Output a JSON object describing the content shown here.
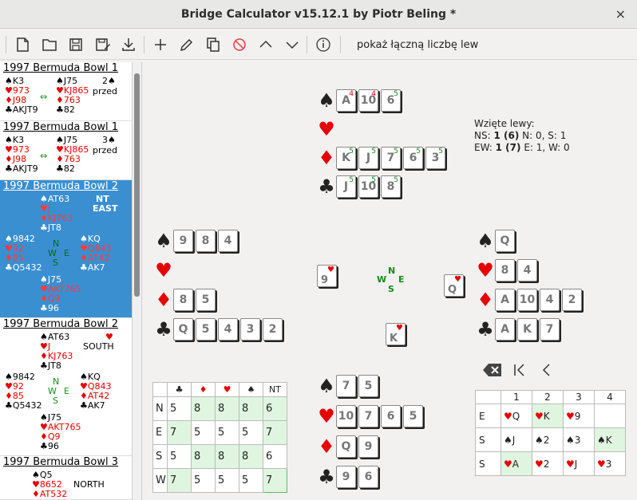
{
  "window": {
    "title": "Bridge Calculator v15.12.1 by Piotr Beling *",
    "close": "×"
  },
  "toolbar": {
    "option_label": "pokaż łączną liczbę lew"
  },
  "sidebar": {
    "deals": [
      {
        "title": "1997 Bermuda Bowl 1",
        "w": [
          "♠K3",
          "♥973",
          "♦J98",
          "♣AKJT9"
        ],
        "e": [
          "♠J75",
          "♥KJ865",
          "♦763",
          "♣82"
        ],
        "arrow": "⇔",
        "info1": "2♠",
        "info2": "przed"
      },
      {
        "title": "1997 Bermuda Bowl 1",
        "w": [
          "♠K3",
          "♥973",
          "♦J98",
          "♣AKJT9"
        ],
        "e": [
          "♠J75",
          "♥KJ865",
          "♦763",
          "♣82"
        ],
        "arrow": "⇔",
        "info1": "3♠",
        "info2": "przed"
      },
      {
        "title": "1997 Bermuda Bowl 2",
        "n": [
          "♠AT63",
          "♥J",
          "♦KJ763",
          "♣JT8"
        ],
        "w": [
          "♠9842",
          "♥92",
          "♦85",
          "♣Q5432"
        ],
        "e": [
          "♠KQ",
          "♥Q843",
          "♦AT42",
          "♣AK7"
        ],
        "s": [
          "♠J75",
          "♥AKT765",
          "♦Q9",
          "♣96"
        ],
        "c": [
          "N",
          "W",
          "E",
          "S"
        ],
        "info1": "NT",
        "info2": "EAST"
      },
      {
        "title": "1997 Bermuda Bowl 2",
        "n": [
          "♠AT63",
          "♥J",
          "♦KJ763",
          "♣JT8"
        ],
        "w": [
          "♠9842",
          "♥92",
          "♦85",
          "♣Q5432"
        ],
        "e": [
          "♠KQ",
          "♥Q843",
          "♦AT42",
          "♣AK7"
        ],
        "s": [
          "♠J75",
          "♥AKT765",
          "♦Q9",
          "♣96"
        ],
        "c": [
          "N",
          "W",
          "E",
          "S"
        ],
        "info1": "♥",
        "info2": "SOUTH"
      },
      {
        "title": "1997 Bermuda Bowl 3",
        "n": [
          "♠Q5",
          "♥8652",
          "♦AT532"
        ],
        "info2": "NORTH"
      }
    ]
  },
  "hands": {
    "north": [
      {
        "suit": "♠",
        "cards": [
          {
            "r": "A",
            "t": "4"
          },
          {
            "r": "10",
            "t": "4"
          },
          {
            "r": "6",
            "t": "5"
          }
        ]
      },
      {
        "suit": "♥",
        "cards": []
      },
      {
        "suit": "♦",
        "cards": [
          {
            "r": "K",
            "t": "5"
          },
          {
            "r": "J",
            "t": "5"
          },
          {
            "r": "7",
            "t": "5"
          },
          {
            "r": "6",
            "t": "5"
          },
          {
            "r": "3",
            "t": "5"
          }
        ]
      },
      {
        "suit": "♣",
        "cards": [
          {
            "r": "J",
            "t": "5"
          },
          {
            "r": "10",
            "t": "5"
          },
          {
            "r": "8",
            "t": "5"
          }
        ]
      }
    ],
    "west": [
      {
        "suit": "♠",
        "cards": [
          {
            "r": "9"
          },
          {
            "r": "8"
          },
          {
            "r": "4"
          }
        ]
      },
      {
        "suit": "♥",
        "cards": []
      },
      {
        "suit": "♦",
        "cards": [
          {
            "r": "8"
          },
          {
            "r": "5"
          }
        ]
      },
      {
        "suit": "♣",
        "cards": [
          {
            "r": "Q"
          },
          {
            "r": "5"
          },
          {
            "r": "4"
          },
          {
            "r": "3"
          },
          {
            "r": "2"
          }
        ]
      }
    ],
    "east": [
      {
        "suit": "♠",
        "cards": [
          {
            "r": "Q"
          }
        ]
      },
      {
        "suit": "♥",
        "cards": [
          {
            "r": "8"
          },
          {
            "r": "4"
          }
        ]
      },
      {
        "suit": "♦",
        "cards": [
          {
            "r": "A"
          },
          {
            "r": "10"
          },
          {
            "r": "4"
          },
          {
            "r": "2"
          }
        ]
      },
      {
        "suit": "♣",
        "cards": [
          {
            "r": "A"
          },
          {
            "r": "K"
          },
          {
            "r": "7"
          }
        ]
      }
    ],
    "south": [
      {
        "suit": "♠",
        "cards": [
          {
            "r": "7"
          },
          {
            "r": "5"
          }
        ]
      },
      {
        "suit": "♥",
        "cards": [
          {
            "r": "10"
          },
          {
            "r": "7"
          },
          {
            "r": "6"
          },
          {
            "r": "5"
          }
        ]
      },
      {
        "suit": "♦",
        "cards": [
          {
            "r": "Q"
          },
          {
            "r": "9"
          }
        ]
      },
      {
        "suit": "♣",
        "cards": [
          {
            "r": "9"
          },
          {
            "r": "6"
          }
        ]
      }
    ]
  },
  "trick": {
    "west": {
      "r": "9",
      "s": "♥"
    },
    "east": {
      "r": "Q",
      "s": "♥"
    },
    "south": {
      "r": "K",
      "s": "♥"
    }
  },
  "compass": {
    "n": "N",
    "w": "W",
    "e": "E",
    "s": "S"
  },
  "tricks_taken": {
    "label": "Wzięte lewy:",
    "ns_prefix": "NS:",
    "ns_value": "1 (6)",
    "ns_rest": "N: 0, S: 1",
    "ew_prefix": "EW:",
    "ew_value": "1 (7)",
    "ew_rest": "E: 1, W: 0"
  },
  "dd_table": {
    "header": [
      "♣",
      "♦",
      "♥",
      "♠",
      "NT"
    ],
    "rows": [
      {
        "p": "N",
        "v": [
          "5",
          "8",
          "8",
          "8",
          "6"
        ]
      },
      {
        "p": "E",
        "v": [
          "7",
          "5",
          "5",
          "5",
          "7"
        ]
      },
      {
        "p": "S",
        "v": [
          "5",
          "8",
          "8",
          "8",
          "6"
        ]
      },
      {
        "p": "W",
        "v": [
          "7",
          "5",
          "5",
          "5",
          "7"
        ]
      }
    ]
  },
  "history": {
    "header": [
      "1",
      "2",
      "3",
      "4"
    ],
    "rows": [
      {
        "p": "E",
        "cells": [
          "♥Q",
          "♥K",
          "♥9",
          ""
        ]
      },
      {
        "p": "S",
        "cells": [
          "♠J",
          "♠2",
          "♠3",
          "♠K"
        ]
      },
      {
        "p": "S",
        "cells": [
          "♥A",
          "♥2",
          "♥J",
          "♥3"
        ]
      }
    ]
  },
  "nav": {
    "clear": "⌫",
    "first": "|‹",
    "prev": "‹"
  },
  "colors": {
    "selection": "#3a8fd1",
    "highlight": "#dff5df",
    "red_suit": "#e60000",
    "compass": "#1a8a1a"
  }
}
